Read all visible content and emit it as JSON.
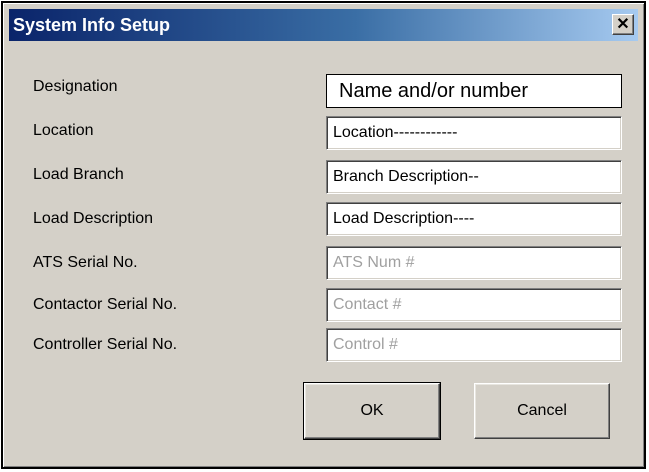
{
  "window": {
    "title": "System Info Setup",
    "close_glyph": "✕"
  },
  "fields": [
    {
      "label": "Designation",
      "value": "Name and/or number",
      "enabled": true
    },
    {
      "label": "Location",
      "value": "Location------------",
      "enabled": true
    },
    {
      "label": "Load Branch",
      "value": "Branch Description--",
      "enabled": true
    },
    {
      "label": "Load Description",
      "value": "Load Description----",
      "enabled": true
    },
    {
      "label": "ATS Serial No.",
      "value": "ATS Num  #",
      "enabled": false
    },
    {
      "label": "Contactor Serial No.",
      "value": "Contact  #",
      "enabled": false
    },
    {
      "label": "Controller Serial No.",
      "value": "Control  #",
      "enabled": false
    }
  ],
  "buttons": {
    "ok_label": "OK",
    "cancel_label": "Cancel"
  },
  "colors": {
    "title_gradient_start": "#0a246a",
    "title_gradient_end": "#a6caf0",
    "dialog_bg": "#d4d0c8",
    "disabled_text": "#a0a0a0"
  }
}
